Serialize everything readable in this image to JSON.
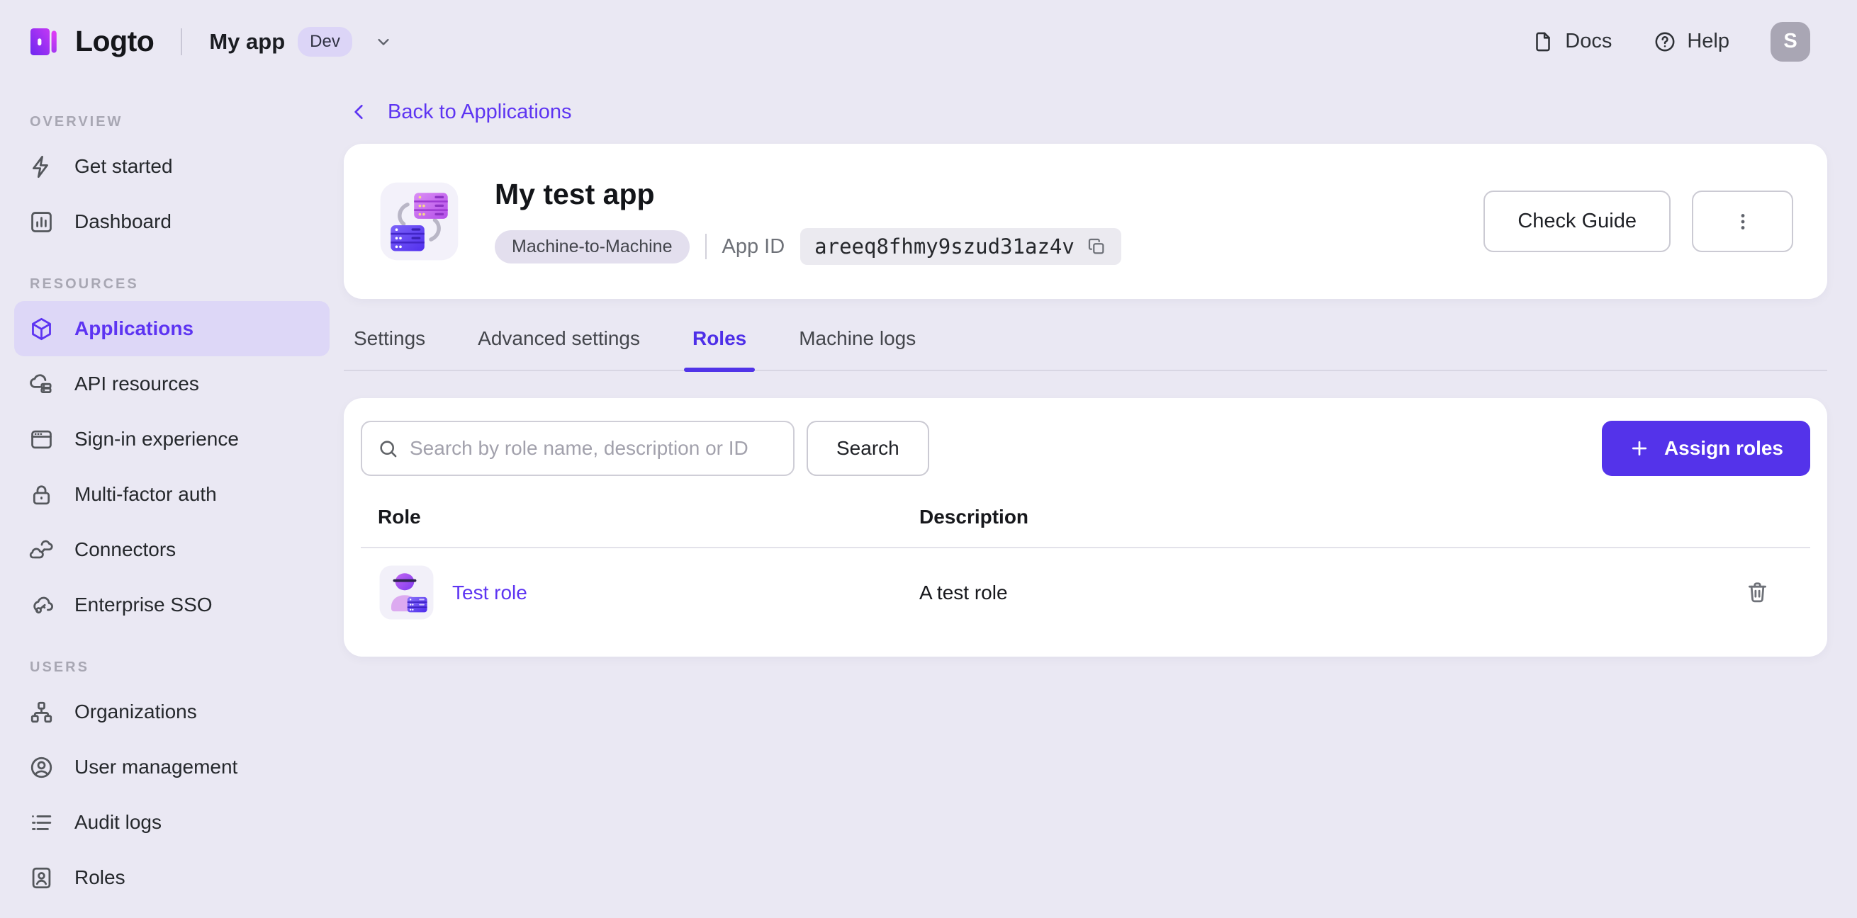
{
  "topbar": {
    "logo_text": "Logto",
    "tenant_name": "My app",
    "tenant_badge": "Dev",
    "docs_label": "Docs",
    "help_label": "Help",
    "avatar_letter": "S"
  },
  "sidebar": {
    "sections": [
      {
        "label": "OVERVIEW",
        "items": [
          {
            "label": "Get started",
            "icon": "lightning"
          },
          {
            "label": "Dashboard",
            "icon": "bar-chart"
          }
        ]
      },
      {
        "label": "RESOURCES",
        "items": [
          {
            "label": "Applications",
            "icon": "cube",
            "active": true
          },
          {
            "label": "API resources",
            "icon": "cloud-box"
          },
          {
            "label": "Sign-in experience",
            "icon": "browser"
          },
          {
            "label": "Multi-factor auth",
            "icon": "lock"
          },
          {
            "label": "Connectors",
            "icon": "clouds"
          },
          {
            "label": "Enterprise SSO",
            "icon": "cloud-key"
          }
        ]
      },
      {
        "label": "USERS",
        "items": [
          {
            "label": "Organizations",
            "icon": "org-chart"
          },
          {
            "label": "User management",
            "icon": "user-circle"
          },
          {
            "label": "Audit logs",
            "icon": "list"
          },
          {
            "label": "Roles",
            "icon": "id-badge"
          }
        ]
      }
    ]
  },
  "content": {
    "back_link": "Back to Applications",
    "app": {
      "title": "My test app",
      "type_badge": "Machine-to-Machine",
      "app_id_label": "App ID",
      "app_id_value": "areeq8fhmy9szud31az4v"
    },
    "actions": {
      "check_guide": "Check Guide"
    },
    "tabs": [
      {
        "label": "Settings"
      },
      {
        "label": "Advanced settings"
      },
      {
        "label": "Roles",
        "active": true
      },
      {
        "label": "Machine logs"
      }
    ],
    "roles_panel": {
      "search_placeholder": "Search by role name, description or ID",
      "search_button": "Search",
      "assign_button": "Assign roles",
      "table": {
        "columns": {
          "role": "Role",
          "description": "Description"
        },
        "rows": [
          {
            "role": "Test role",
            "description": "A test role"
          }
        ]
      }
    }
  },
  "colors": {
    "accent": "#5d34f2",
    "accent_button": "#5433ea",
    "page_background": "#eae8f3",
    "active_item_background": "#ddd7f7",
    "card_background": "#ffffff",
    "badge_background": "#dcd5f7",
    "type_badge_background": "#e3dfee",
    "appid_pill_background": "#ebeaf0",
    "avatar_background": "#a9a6b4"
  }
}
